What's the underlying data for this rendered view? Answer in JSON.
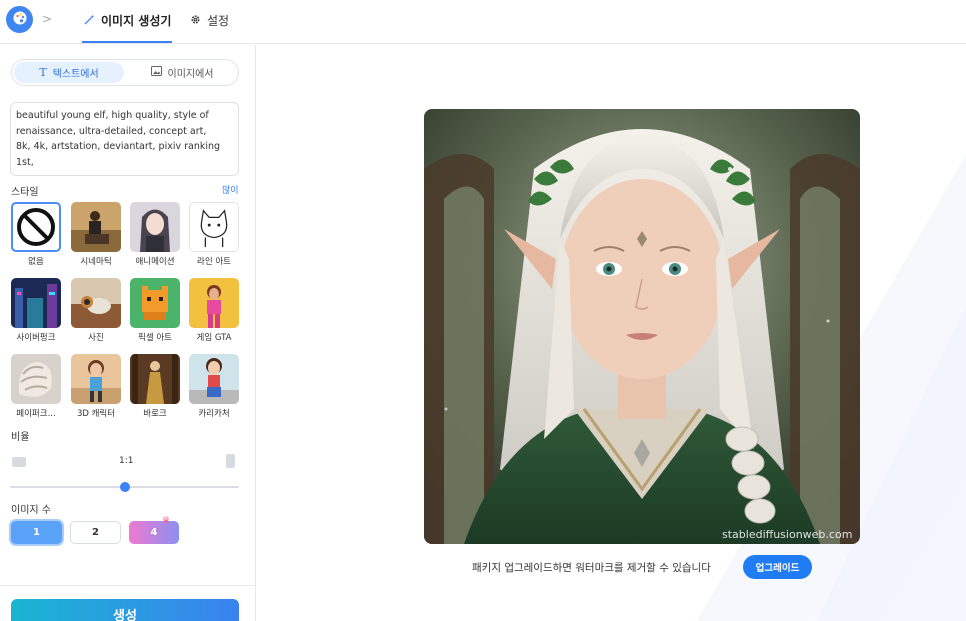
{
  "header": {
    "breadcrumb_separator": ">",
    "tabs": [
      {
        "label": "이미지 생성기",
        "icon": "magic-wand-icon",
        "active": true
      },
      {
        "label": "설정",
        "icon": "gear-icon",
        "active": false
      }
    ]
  },
  "mode": {
    "options": [
      {
        "label": "텍스트에서",
        "icon": "text-icon",
        "active": true
      },
      {
        "label": "이미지에서",
        "icon": "image-icon",
        "active": false
      }
    ]
  },
  "prompt": {
    "value": "beautiful young elf, high quality, style of\nrenaissance, ultra-detailed, concept art,\n8k, 4k, artstation, deviantart, pixiv ranking 1st,"
  },
  "style": {
    "label": "스타일",
    "more": "많이",
    "items": [
      {
        "label": "없음",
        "icon": "none-icon",
        "selected": true
      },
      {
        "label": "시네마틱"
      },
      {
        "label": "애니메이션"
      },
      {
        "label": "라인 아트"
      },
      {
        "label": "사이버펑크"
      },
      {
        "label": "사진"
      },
      {
        "label": "픽셀 아트"
      },
      {
        "label": "게임 GTA"
      },
      {
        "label": "페이퍼크..."
      },
      {
        "label": "3D 캐릭터"
      },
      {
        "label": "바로크"
      },
      {
        "label": "카리카처"
      }
    ]
  },
  "ratio": {
    "label": "비율",
    "value": "1:1",
    "slider_fraction": 0.5
  },
  "image_count": {
    "label": "이미지 수",
    "options": [
      "1",
      "2",
      "4"
    ],
    "selected": "1",
    "premium_option": "4"
  },
  "generate": {
    "label": "생성"
  },
  "result": {
    "watermark": "stablediffusionweb.com"
  },
  "upgrade": {
    "notice": "패키지 업그레이드하면 워터마크를 제거할 수 있습니다",
    "button": "업그레이드"
  },
  "colors": {
    "accent": "#3b82f6",
    "generate_start": "#1ab5d2",
    "generate_end": "#3a82ef",
    "upgrade": "#1f7cf2"
  }
}
